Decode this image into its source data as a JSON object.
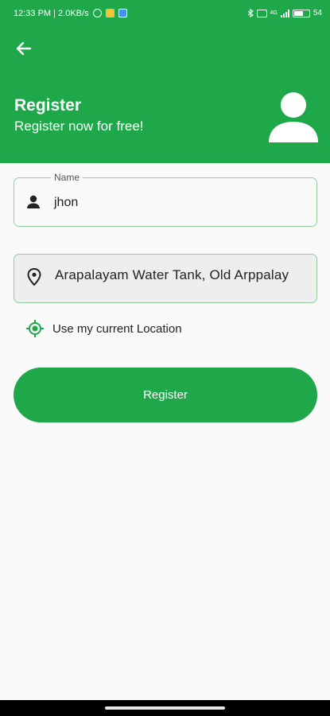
{
  "status_bar": {
    "time_and_speed": "12:33 PM | 2.0KB/s",
    "network_label": "4G",
    "battery": "54"
  },
  "header": {
    "title": "Register",
    "subtitle": "Register now for free!"
  },
  "form": {
    "name_field": {
      "label": "Name",
      "value": "jhon"
    },
    "location_field": {
      "value": "Arapalayam Water Tank, Old Arppalay"
    },
    "use_current_location_label": "Use my current Location",
    "register_button_label": "Register"
  },
  "icons": {
    "back": "arrow-left-icon",
    "avatar": "person-icon",
    "name": "person-icon",
    "location": "location-pin-icon",
    "gps": "gps-target-icon"
  },
  "colors": {
    "primary": "#1ea84a",
    "field_border": "#8ecf9c",
    "background": "#fafafa"
  }
}
